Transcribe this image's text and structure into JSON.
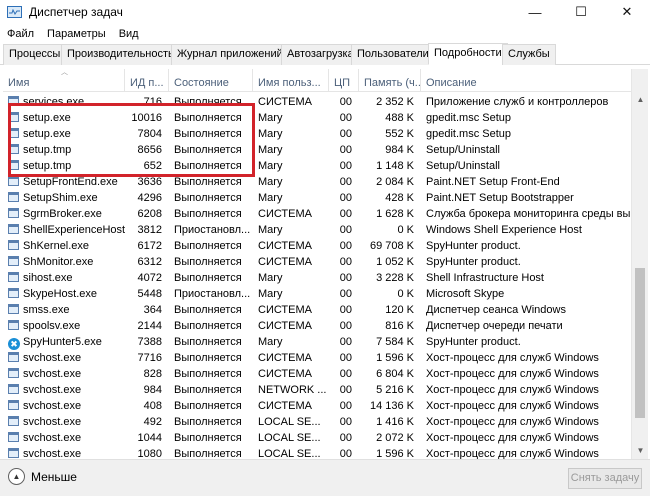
{
  "window": {
    "title": "Диспетчер задач",
    "controls": {
      "minimize": "—",
      "maximize": "☐",
      "close": "✕"
    }
  },
  "menu": [
    "Файл",
    "Параметры",
    "Вид"
  ],
  "tabs": [
    {
      "label": "Процессы",
      "active": false
    },
    {
      "label": "Производительность",
      "active": false
    },
    {
      "label": "Журнал приложений",
      "active": false
    },
    {
      "label": "Автозагрузка",
      "active": false
    },
    {
      "label": "Пользователи",
      "active": false
    },
    {
      "label": "Подробности",
      "active": true
    },
    {
      "label": "Службы",
      "active": false
    }
  ],
  "columns": [
    "Имя",
    "ИД п...",
    "Состояние",
    "Имя польз...",
    "ЦП",
    "Память (ч...",
    "Описание"
  ],
  "rows": [
    {
      "name": "services.exe",
      "pid": "716",
      "status": "Выполняется",
      "user": "СИСТЕМА",
      "cpu": "00",
      "mem": "2 352 K",
      "desc": "Приложение служб и контроллеров",
      "icon": "process-icon"
    },
    {
      "name": "setup.exe",
      "pid": "10016",
      "status": "Выполняется",
      "user": "Mary",
      "cpu": "00",
      "mem": "488 K",
      "desc": "gpedit.msc Setup",
      "icon": "process-icon"
    },
    {
      "name": "setup.exe",
      "pid": "7804",
      "status": "Выполняется",
      "user": "Mary",
      "cpu": "00",
      "mem": "552 K",
      "desc": "gpedit.msc Setup",
      "icon": "process-icon"
    },
    {
      "name": "setup.tmp",
      "pid": "8656",
      "status": "Выполняется",
      "user": "Mary",
      "cpu": "00",
      "mem": "984 K",
      "desc": "Setup/Uninstall",
      "icon": "process-icon"
    },
    {
      "name": "setup.tmp",
      "pid": "652",
      "status": "Выполняется",
      "user": "Mary",
      "cpu": "00",
      "mem": "1 148 K",
      "desc": "Setup/Uninstall",
      "icon": "process-icon"
    },
    {
      "name": "SetupFrontEnd.exe",
      "pid": "3636",
      "status": "Выполняется",
      "user": "Mary",
      "cpu": "00",
      "mem": "2 084 K",
      "desc": "Paint.NET Setup Front-End",
      "icon": "process-icon"
    },
    {
      "name": "SetupShim.exe",
      "pid": "4296",
      "status": "Выполняется",
      "user": "Mary",
      "cpu": "00",
      "mem": "428 K",
      "desc": "Paint.NET Setup Bootstrapper",
      "icon": "process-icon"
    },
    {
      "name": "SgrmBroker.exe",
      "pid": "6208",
      "status": "Выполняется",
      "user": "СИСТЕМА",
      "cpu": "00",
      "mem": "1 628 K",
      "desc": "Служба брокера мониторинга среды вы",
      "icon": "process-icon"
    },
    {
      "name": "ShellExperienceHost...",
      "pid": "3812",
      "status": "Приостановл...",
      "user": "Mary",
      "cpu": "00",
      "mem": "0 K",
      "desc": "Windows Shell Experience Host",
      "icon": "process-icon"
    },
    {
      "name": "ShKernel.exe",
      "pid": "6172",
      "status": "Выполняется",
      "user": "СИСТЕМА",
      "cpu": "00",
      "mem": "69 708 K",
      "desc": "SpyHunter product.",
      "icon": "process-icon"
    },
    {
      "name": "ShMonitor.exe",
      "pid": "6312",
      "status": "Выполняется",
      "user": "СИСТЕМА",
      "cpu": "00",
      "mem": "1 052 K",
      "desc": "SpyHunter product.",
      "icon": "process-icon"
    },
    {
      "name": "sihost.exe",
      "pid": "4072",
      "status": "Выполняется",
      "user": "Mary",
      "cpu": "00",
      "mem": "3 228 K",
      "desc": "Shell Infrastructure Host",
      "icon": "process-icon"
    },
    {
      "name": "SkypeHost.exe",
      "pid": "5448",
      "status": "Приостановл...",
      "user": "Mary",
      "cpu": "00",
      "mem": "0 K",
      "desc": "Microsoft Skype",
      "icon": "process-icon"
    },
    {
      "name": "smss.exe",
      "pid": "364",
      "status": "Выполняется",
      "user": "СИСТЕМА",
      "cpu": "00",
      "mem": "120 K",
      "desc": "Диспетчер сеанса  Windows",
      "icon": "process-icon"
    },
    {
      "name": "spoolsv.exe",
      "pid": "2144",
      "status": "Выполняется",
      "user": "СИСТЕМА",
      "cpu": "00",
      "mem": "816 K",
      "desc": "Диспетчер очереди печати",
      "icon": "process-icon"
    },
    {
      "name": "SpyHunter5.exe",
      "pid": "7388",
      "status": "Выполняется",
      "user": "Mary",
      "cpu": "00",
      "mem": "7 584 K",
      "desc": "SpyHunter product.",
      "icon": "spyhunter-icon"
    },
    {
      "name": "svchost.exe",
      "pid": "7716",
      "status": "Выполняется",
      "user": "СИСТЕМА",
      "cpu": "00",
      "mem": "1 596 K",
      "desc": "Хост-процесс для служб Windows",
      "icon": "process-icon"
    },
    {
      "name": "svchost.exe",
      "pid": "828",
      "status": "Выполняется",
      "user": "СИСТЕМА",
      "cpu": "00",
      "mem": "6 804 K",
      "desc": "Хост-процесс для служб Windows",
      "icon": "process-icon"
    },
    {
      "name": "svchost.exe",
      "pid": "984",
      "status": "Выполняется",
      "user": "NETWORK ...",
      "cpu": "00",
      "mem": "5 216 K",
      "desc": "Хост-процесс для служб Windows",
      "icon": "process-icon"
    },
    {
      "name": "svchost.exe",
      "pid": "408",
      "status": "Выполняется",
      "user": "СИСТЕМА",
      "cpu": "00",
      "mem": "14 136 K",
      "desc": "Хост-процесс для служб Windows",
      "icon": "process-icon"
    },
    {
      "name": "svchost.exe",
      "pid": "492",
      "status": "Выполняется",
      "user": "LOCAL SE...",
      "cpu": "00",
      "mem": "1 416 K",
      "desc": "Хост-процесс для служб Windows",
      "icon": "process-icon"
    },
    {
      "name": "svchost.exe",
      "pid": "1044",
      "status": "Выполняется",
      "user": "LOCAL SE...",
      "cpu": "00",
      "mem": "2 072 K",
      "desc": "Хост-процесс для служб Windows",
      "icon": "process-icon"
    },
    {
      "name": "svchost.exe",
      "pid": "1080",
      "status": "Выполняется",
      "user": "LOCAL SE...",
      "cpu": "00",
      "mem": "1 596 K",
      "desc": "Хост-процесс для служб Windows",
      "icon": "process-icon"
    }
  ],
  "footer": {
    "fewer_label": "Меньше",
    "end_task_label": "Снять задачу"
  },
  "colors": {
    "highlight": "#d2232a",
    "header_text": "#4c607a"
  }
}
